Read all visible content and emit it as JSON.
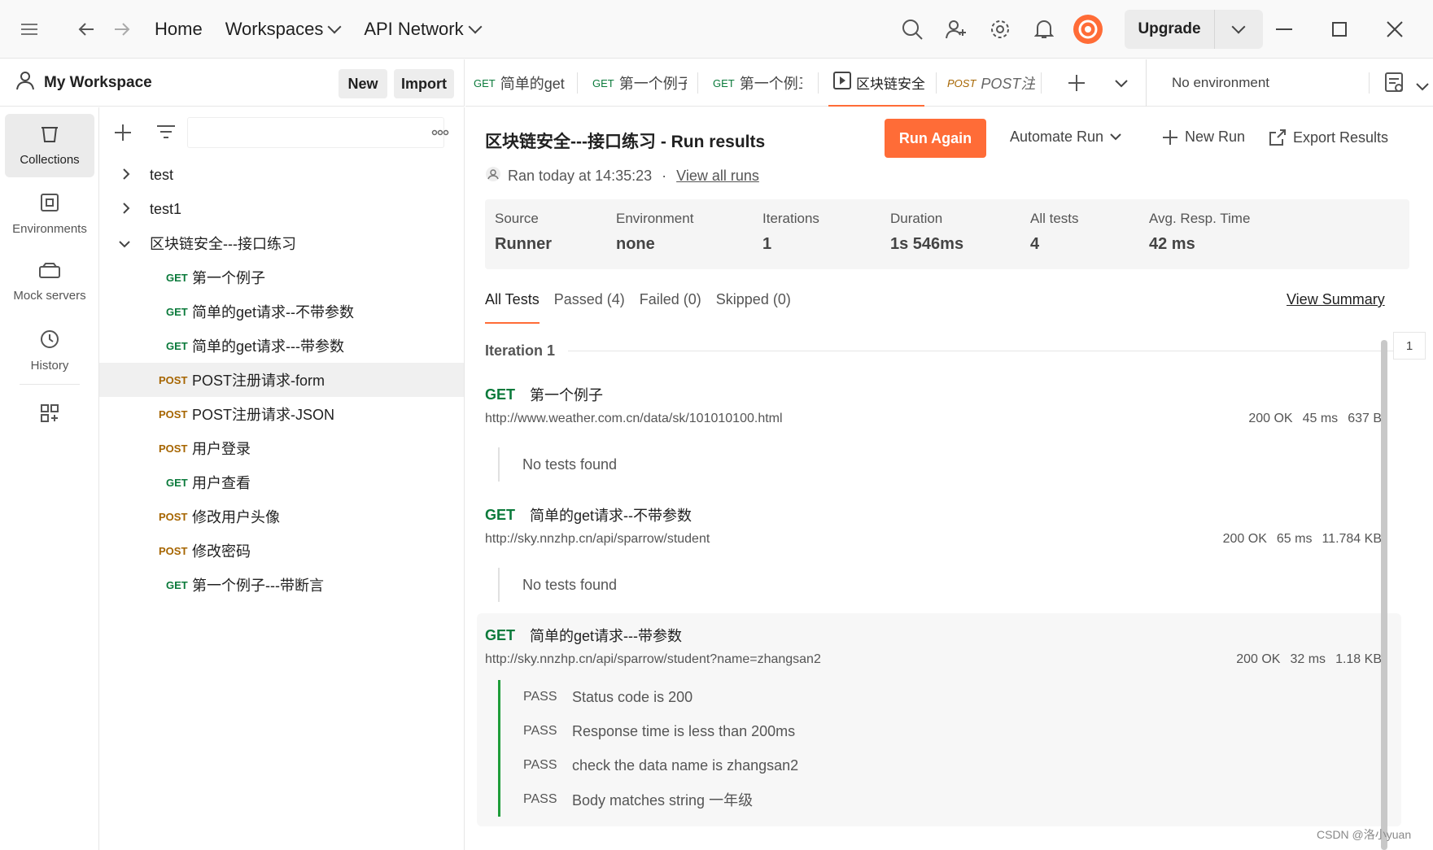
{
  "topbar": {
    "nav_home": "Home",
    "nav_workspaces": "Workspaces",
    "nav_api_network": "API Network",
    "upgrade_label": "Upgrade"
  },
  "workspace": {
    "title": "My Workspace",
    "new_label": "New",
    "import_label": "Import"
  },
  "leftnav": {
    "collections": "Collections",
    "environments": "Environments",
    "mock_servers": "Mock servers",
    "history": "History"
  },
  "tree": {
    "rows": [
      {
        "method": "",
        "label": "test"
      },
      {
        "method": "",
        "label": "test1"
      },
      {
        "method": "",
        "label": "区块链安全---接口练习"
      },
      {
        "method": "GET",
        "label": "第一个例子"
      },
      {
        "method": "GET",
        "label": "简单的get请求--不带参数"
      },
      {
        "method": "GET",
        "label": "简单的get请求---带参数"
      },
      {
        "method": "POST",
        "label": "POST注册请求-form"
      },
      {
        "method": "POST",
        "label": "POST注册请求-JSON"
      },
      {
        "method": "POST",
        "label": "用户登录"
      },
      {
        "method": "GET",
        "label": "用户查看"
      },
      {
        "method": "POST",
        "label": "修改用户头像"
      },
      {
        "method": "POST",
        "label": "修改密码"
      },
      {
        "method": "GET",
        "label": "第一个例子---带断言"
      }
    ]
  },
  "tabs": [
    {
      "method": "GET",
      "label": "简单的get"
    },
    {
      "method": "GET",
      "label": "第一个例子"
    },
    {
      "method": "GET",
      "label": "第一个例三"
    },
    {
      "method": "",
      "label": "区块链安全"
    },
    {
      "method": "POST",
      "label": "POST注册"
    }
  ],
  "environment": {
    "selected": "No environment"
  },
  "run": {
    "title": "区块链安全---接口练习 - Run results",
    "run_again": "Run Again",
    "automate_run": "Automate Run",
    "new_run": "New Run",
    "export_results": "Export Results",
    "ran_text": "Ran today at 14:35:23",
    "dot": "·",
    "view_all_runs": "View all runs"
  },
  "stats": [
    {
      "label": "Source",
      "value": "Runner"
    },
    {
      "label": "Environment",
      "value": "none"
    },
    {
      "label": "Iterations",
      "value": "1"
    },
    {
      "label": "Duration",
      "value": "1s 546ms"
    },
    {
      "label": "All tests",
      "value": "4"
    },
    {
      "label": "Avg. Resp. Time",
      "value": "42 ms"
    }
  ],
  "filters": {
    "all": "All Tests",
    "passed": "Passed (4)",
    "failed": "Failed (0)",
    "skipped": "Skipped (0)",
    "view_summary": "View Summary"
  },
  "iteration": {
    "label": "Iteration 1",
    "number": "1"
  },
  "requests": [
    {
      "method": "GET",
      "name": "第一个例子",
      "url": "http://www.weather.com.cn/data/sk/101010100.html",
      "status": "200 OK",
      "time": "45 ms",
      "size": "637 B",
      "no_tests": "No tests found"
    },
    {
      "method": "GET",
      "name": "简单的get请求--不带参数",
      "url": "http://sky.nnzhp.cn/api/sparrow/student",
      "status": "200 OK",
      "time": "65 ms",
      "size": "11.784 KB",
      "no_tests": "No tests found"
    },
    {
      "method": "GET",
      "name": "简单的get请求---带参数",
      "url": "http://sky.nnzhp.cn/api/sparrow/student?name=zhangsan2",
      "status": "200 OK",
      "time": "32 ms",
      "size": "1.18 KB",
      "tests": [
        {
          "status": "PASS",
          "name": "Status code is 200"
        },
        {
          "status": "PASS",
          "name": "Response time is less than 200ms"
        },
        {
          "status": "PASS",
          "name": "check the data name is zhangsan2"
        },
        {
          "status": "PASS",
          "name": "Body matches string 一年级"
        }
      ]
    }
  ],
  "watermark": "CSDN @洛小yuan",
  "colors": {
    "accent": "#ff6c37",
    "get": "#0b7a3b",
    "post": "#a66500",
    "pass": "#1f9d3a"
  }
}
